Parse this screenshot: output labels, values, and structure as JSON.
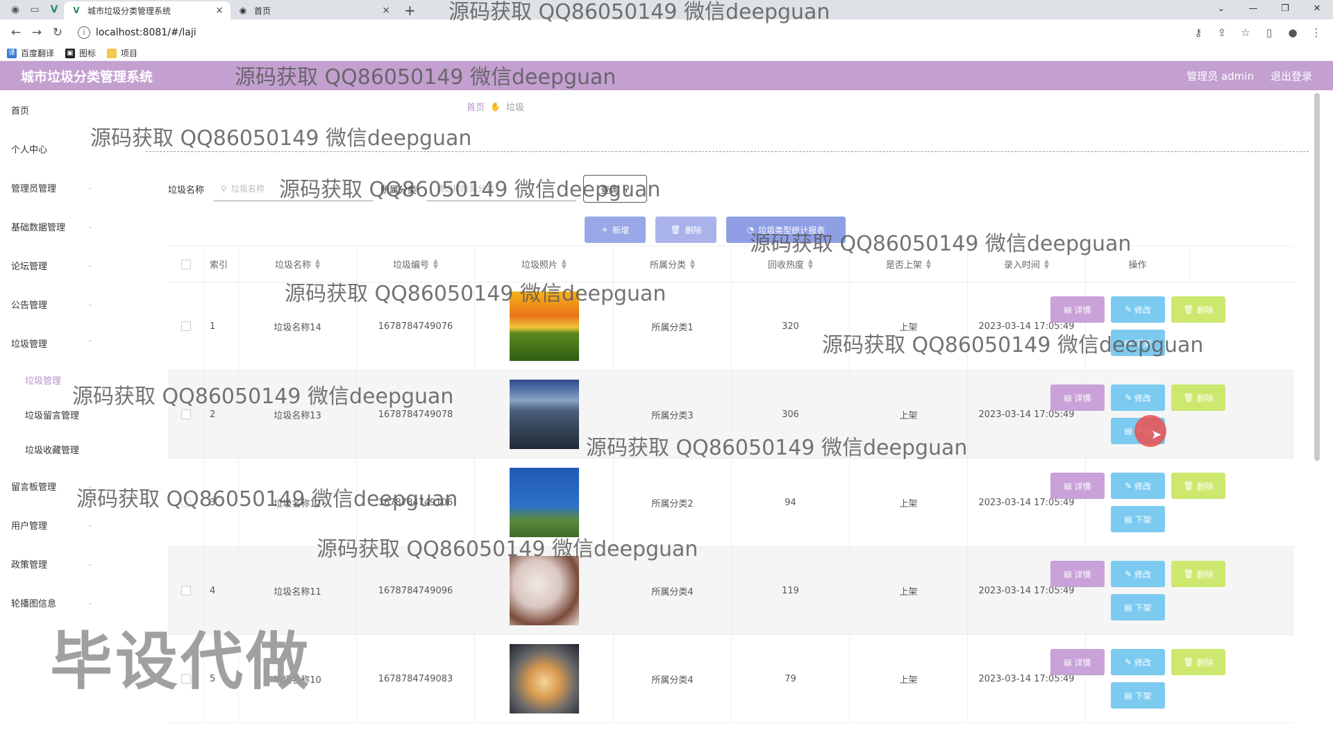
{
  "browser": {
    "tabs": [
      {
        "title": "城市垃圾分类管理系统",
        "active": true
      },
      {
        "title": "首页",
        "active": false
      }
    ],
    "url": "localhost:8081/#/laji",
    "bookmarks": [
      "百度翻译",
      "图标",
      "项目"
    ]
  },
  "header": {
    "title": "城市垃圾分类管理系统",
    "user": "管理员 admin",
    "logout": "退出登录"
  },
  "sidebar": {
    "items": [
      {
        "label": "首页"
      },
      {
        "label": "个人中心"
      },
      {
        "label": "管理员管理"
      },
      {
        "label": "基础数据管理"
      },
      {
        "label": "论坛管理"
      },
      {
        "label": "公告管理"
      },
      {
        "label": "垃圾管理"
      }
    ],
    "subitems": [
      {
        "label": "垃圾管理",
        "active": true
      },
      {
        "label": "垃圾留言管理"
      },
      {
        "label": "垃圾收藏管理"
      }
    ],
    "items_after": [
      {
        "label": "留言板管理"
      },
      {
        "label": "用户管理"
      },
      {
        "label": "政策管理"
      },
      {
        "label": "轮播图信息"
      }
    ]
  },
  "breadcrumb": {
    "home": "首页",
    "current": "垃圾"
  },
  "filters": {
    "name_label": "垃圾名称",
    "name_placeholder": "垃圾名称",
    "category_label": "所属分类",
    "category_placeholder": "请选择所属分类",
    "query_button": "查询"
  },
  "actions": {
    "add": "新增",
    "delete": "删除",
    "report": "垃圾类型统计报表"
  },
  "table": {
    "headers": [
      "索引",
      "垃圾名称",
      "垃圾编号",
      "垃圾照片",
      "所属分类",
      "回收热度",
      "是否上架",
      "录入时间",
      "操作"
    ],
    "row_buttons": {
      "detail": "详情",
      "edit": "修改",
      "remove": "删除",
      "shelf": "下架"
    },
    "rows": [
      {
        "index": "1",
        "name": "垃圾名称14",
        "code": "1678784749076",
        "category": "所属分类1",
        "heat": "320",
        "status": "上架",
        "time": "2023-03-14 17:05:49",
        "photo": "sunset-field"
      },
      {
        "index": "2",
        "name": "垃圾名称13",
        "code": "1678784749078",
        "category": "所属分类3",
        "heat": "306",
        "status": "上架",
        "time": "2023-03-14 17:05:49",
        "photo": "city-mountain"
      },
      {
        "index": "3",
        "name": "垃圾名称12",
        "code": "1678784749106",
        "category": "所属分类2",
        "heat": "94",
        "status": "上架",
        "time": "2023-03-14 17:05:49",
        "photo": "sea-girl"
      },
      {
        "index": "4",
        "name": "垃圾名称11",
        "code": "1678784749096",
        "category": "所属分类4",
        "heat": "119",
        "status": "上架",
        "time": "2023-03-14 17:05:49",
        "photo": "blossom"
      },
      {
        "index": "5",
        "name": "垃圾名称10",
        "code": "1678784749083",
        "category": "所属分类4",
        "heat": "79",
        "status": "上架",
        "time": "2023-03-14 17:05:49",
        "photo": "fisheye-sunset"
      }
    ]
  },
  "watermarks": {
    "text": "源码获取 QQ86050149 微信deepguan",
    "big": "毕设代做"
  },
  "colors": {
    "header": "#c3a0d0",
    "accent": "#b98fd0",
    "detail": "#c8a2d8",
    "edit": "#7ccaf0",
    "remove": "#cde86f",
    "report": "#8f9fe6"
  }
}
